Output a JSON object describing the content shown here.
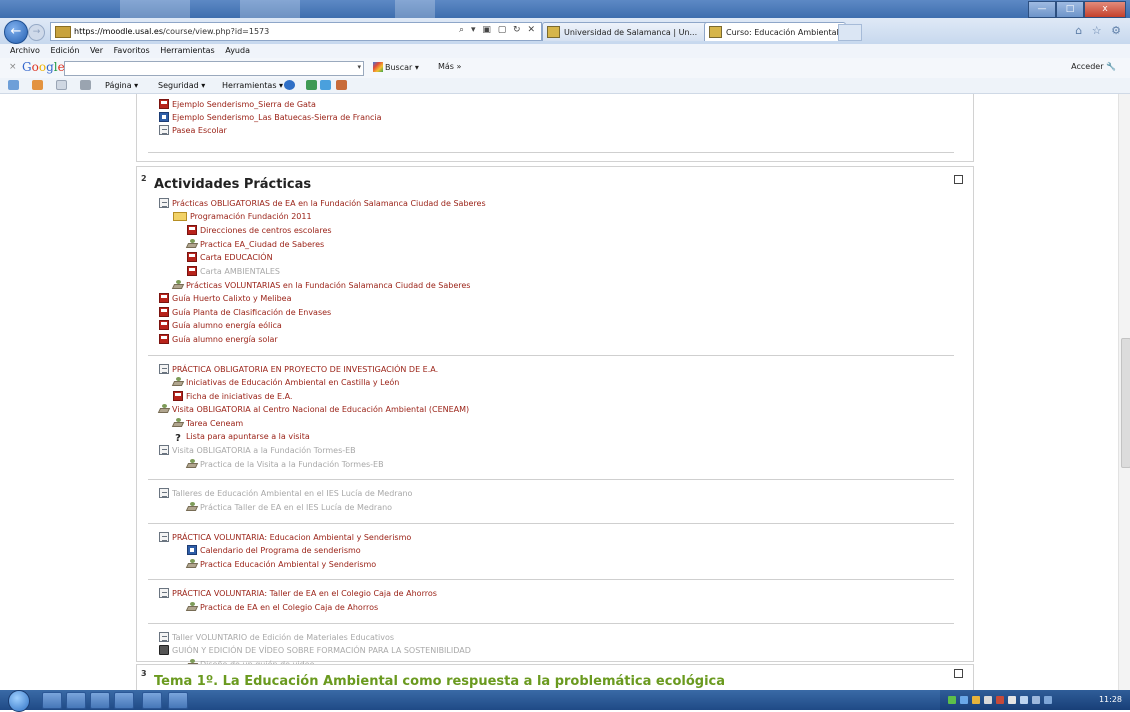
{
  "browser": {
    "address_url_host": "https://moodle.usal.es",
    "address_url_path": "/course/view.php?id=1573",
    "address_icons": "⌕ ▾ ▣ ▢ ↻ ✕",
    "tabs": [
      {
        "title": "Universidad de Salamanca | Un..."
      },
      {
        "title": "Curso: Educación Ambiental",
        "close": "×"
      }
    ],
    "right_icons": "⌂ ☆ ⚙"
  },
  "window_controls": {
    "minimize": "—",
    "maximize": "□",
    "close": "x"
  },
  "menu": [
    "Archivo",
    "Edición",
    "Ver",
    "Favoritos",
    "Herramientas",
    "Ayuda"
  ],
  "google_toolbar": {
    "close": "×",
    "logo": "Google",
    "search_value": "",
    "dropdown": "▾",
    "search_button": "Buscar ▾",
    "more": "Más »",
    "signin": "Acceder"
  },
  "command_bar": {
    "page": "Página ▾",
    "safety": "Seguridad ▾",
    "tools": "Herramientas ▾",
    "arrows": "▾ ▾ ▾ ▾"
  },
  "section1_tail": {
    "items": [
      {
        "icon": "pdf",
        "label": "Ejemplo Senderismo_Sierra de Gata"
      },
      {
        "icon": "word",
        "label": "Ejemplo Senderismo_Las Batuecas-Sierra de Francia"
      },
      {
        "icon": "doc",
        "label": "Pasea Escolar"
      }
    ]
  },
  "section2": {
    "number": "2",
    "title": "Actividades Prácticas",
    "groups": [
      [
        {
          "icon": "doc",
          "label": "Prácticas OBLIGATORIAS de EA en la Fundación Salamanca Ciudad de Saberes",
          "indent": 0,
          "dim": false
        },
        {
          "icon": "folder",
          "label": "Programación Fundación 2011",
          "indent": 1,
          "dim": false
        },
        {
          "icon": "pdf",
          "label": "Direcciones de centros escolares",
          "indent": 2,
          "dim": false
        },
        {
          "icon": "assign",
          "label": "Practica EA_Ciudad de Saberes",
          "indent": 2,
          "dim": false
        },
        {
          "icon": "pdf",
          "label": "Carta EDUCACIÓN",
          "indent": 2,
          "dim": false
        },
        {
          "icon": "pdf",
          "label": "Carta AMBIENTALES",
          "indent": 2,
          "dim": true
        },
        {
          "icon": "assign",
          "label": "Prácticas VOLUNTARIAS en la Fundación Salamanca Ciudad de Saberes",
          "indent": 1,
          "dim": false
        },
        {
          "icon": "pdf",
          "label": "Guía Huerto Calixto y Melibea",
          "indent": 0,
          "dim": false
        },
        {
          "icon": "pdf",
          "label": "Guía Planta de Clasificación de Envases",
          "indent": 0,
          "dim": false
        },
        {
          "icon": "pdf",
          "label": "Guía alumno energía eólica",
          "indent": 0,
          "dim": false
        },
        {
          "icon": "pdf",
          "label": "Guía alumno energía solar",
          "indent": 0,
          "dim": false
        }
      ],
      [
        {
          "icon": "doc",
          "label": "PRÁCTICA OBLIGATORIA EN PROYECTO DE INVESTIGACIÓN DE E.A.",
          "indent": 0,
          "dim": false
        },
        {
          "icon": "assign",
          "label": "Iniciativas de Educación Ambiental en Castilla y León",
          "indent": 1,
          "dim": false
        },
        {
          "icon": "pdf",
          "label": "Ficha de iniciativas de E.A.",
          "indent": 1,
          "dim": false
        },
        {
          "icon": "assign",
          "label": "Visita OBLIGATORIA al Centro Nacional de Educación Ambiental (CENEAM)",
          "indent": 0,
          "dim": false
        },
        {
          "icon": "assign",
          "label": "Tarea Ceneam",
          "indent": 1,
          "dim": false
        },
        {
          "icon": "quest",
          "label": "Lista para apuntarse a la visita",
          "indent": 1,
          "dim": false
        },
        {
          "icon": "doc",
          "label": "Visita OBLIGATORIA a la Fundación Tormes-EB",
          "indent": 0,
          "dim": true
        },
        {
          "icon": "assign",
          "label": "Practica de la Visita a la Fundación Tormes-EB",
          "indent": 2,
          "dim": true
        }
      ],
      [
        {
          "icon": "doc",
          "label": "Talleres de Educación Ambiental en el IES Lucía de Medrano",
          "indent": 0,
          "dim": true
        },
        {
          "icon": "assign",
          "label": "Práctica Taller de EA en el IES Lucía de Medrano",
          "indent": 2,
          "dim": true
        }
      ],
      [
        {
          "icon": "doc",
          "label": "PRÁCTICA VOLUNTARIA: Educacion Ambiental y Senderismo",
          "indent": 0,
          "dim": false
        },
        {
          "icon": "word",
          "label": "Calendario del Programa de senderismo",
          "indent": 2,
          "dim": false
        },
        {
          "icon": "assign",
          "label": "Practica Educación Ambiental y Senderismo",
          "indent": 2,
          "dim": false
        }
      ],
      [
        {
          "icon": "doc",
          "label": "PRÁCTICA VOLUNTARIA: Taller de EA en el Colegio Caja de Ahorros",
          "indent": 0,
          "dim": false
        },
        {
          "icon": "assign",
          "label": "Practica de EA en el Colegio Caja de Ahorros",
          "indent": 2,
          "dim": false
        }
      ],
      [
        {
          "icon": "doc",
          "label": "Taller VOLUNTARIO de Edición de Materiales Educativos",
          "indent": 0,
          "dim": true
        },
        {
          "icon": "vid",
          "label": "GUIÓN Y EDICIÓN DE VÍDEO SOBRE FORMACIÓN PARA LA SOSTENIBILIDAD",
          "indent": 0,
          "dim": true
        },
        {
          "icon": "assign",
          "label": "Diseño de un guión de video",
          "indent": 2,
          "dim": true
        }
      ]
    ]
  },
  "section3": {
    "number": "3",
    "title": "Tema 1º. La Educación Ambiental como respuesta a la problemática ecológica"
  },
  "taskbar": {
    "clock": "11:28"
  },
  "colors": {
    "link": "#9b2318",
    "dim_link": "#a8a8a8",
    "section3_title": "#6a9a1f",
    "browser_chrome": "#c7d8ee",
    "taskbar": "#1f4a86"
  }
}
